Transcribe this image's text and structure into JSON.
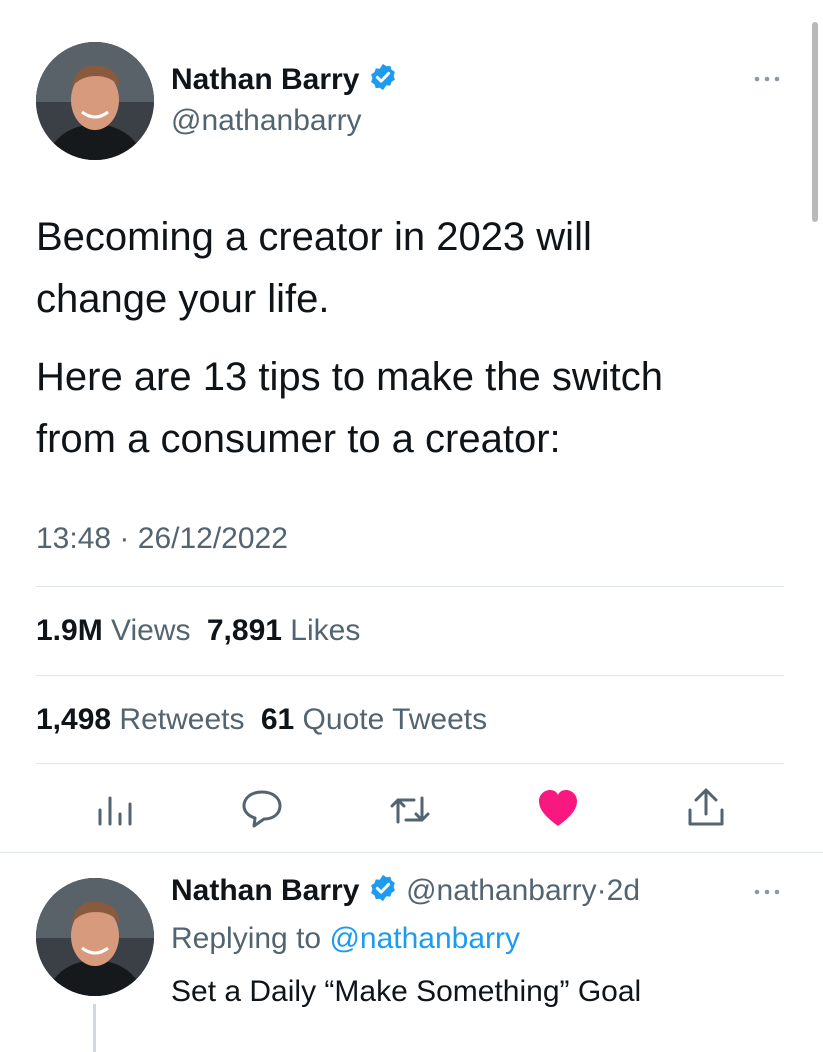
{
  "author": {
    "name": "Nathan Barry",
    "handle": "@nathanbarry"
  },
  "tweet": {
    "paragraph1_line1": "Becoming a creator in 2023 will",
    "paragraph1_line2": "change your life.",
    "paragraph2_line1": "Here are 13 tips to make the switch",
    "paragraph2_line2": "from a consumer to a creator:",
    "time": "13:48",
    "separator": "·",
    "date": "26/12/2022"
  },
  "stats": {
    "views_count": "1.9M",
    "views_label": "Views",
    "likes_count": "7,891",
    "likes_label": "Likes",
    "retweets_count": "1,498",
    "retweets_label": "Retweets",
    "quotes_count": "61",
    "quotes_label": "Quote Tweets"
  },
  "actions": [
    "analytics-icon",
    "reply-icon",
    "retweet-icon",
    "like-icon",
    "share-icon"
  ],
  "reply": {
    "name": "Nathan Barry",
    "handle": "@nathanbarry",
    "separator": "·",
    "age": "2d",
    "replying_prefix": "Replying to",
    "replying_to": "@nathanbarry",
    "text": "Set a Daily “Make Something” Goal"
  },
  "colors": {
    "accent": "#1d9bf0",
    "like": "#f91880",
    "secondary_text": "#536471"
  }
}
